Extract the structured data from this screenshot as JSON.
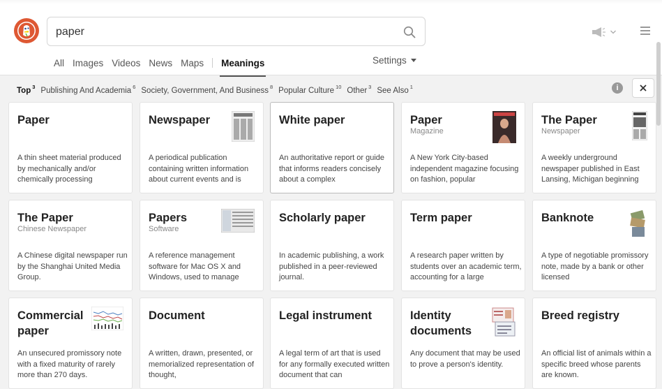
{
  "search": {
    "query": "paper"
  },
  "nav": {
    "all": "All",
    "images": "Images",
    "videos": "Videos",
    "news": "News",
    "maps": "Maps",
    "meanings": "Meanings",
    "settings": "Settings"
  },
  "filters": [
    {
      "label": "Top",
      "count": "3"
    },
    {
      "label": "Publishing And Academia",
      "count": "6"
    },
    {
      "label": "Society, Government, And Business",
      "count": "8"
    },
    {
      "label": "Popular Culture",
      "count": "10"
    },
    {
      "label": "Other",
      "count": "3"
    },
    {
      "label": "See Also",
      "count": "1"
    }
  ],
  "info_label": "i",
  "cards": [
    {
      "title": "Paper",
      "sub": "",
      "desc": "A thin sheet material produced by mechanically and/or chemically processing"
    },
    {
      "title": "Newspaper",
      "sub": "",
      "desc": "A periodical publication containing written information about current events and is"
    },
    {
      "title": "White paper",
      "sub": "",
      "desc": "An authoritative report or guide that informs readers concisely about a complex"
    },
    {
      "title": "Paper",
      "sub": "Magazine",
      "desc": "A New York City-based independent magazine focusing on fashion, popular"
    },
    {
      "title": "The Paper",
      "sub": "Newspaper",
      "desc": "A weekly underground newspaper published in East Lansing, Michigan beginning"
    },
    {
      "title": "The Paper",
      "sub": "Chinese Newspaper",
      "desc": "A Chinese digital newspaper run by the Shanghai United Media Group."
    },
    {
      "title": "Papers",
      "sub": "Software",
      "desc": "A reference management software for Mac OS X and Windows, used to manage"
    },
    {
      "title": "Scholarly paper",
      "sub": "",
      "desc": "In academic publishing, a work published in a peer-reviewed journal."
    },
    {
      "title": "Term paper",
      "sub": "",
      "desc": "A research paper written by students over an academic term, accounting for a large"
    },
    {
      "title": "Banknote",
      "sub": "",
      "desc": "A type of negotiable promissory note, made by a bank or other licensed"
    },
    {
      "title": "Commercial paper",
      "sub": "",
      "desc": "An unsecured promissory note with a fixed maturity of rarely more than 270 days."
    },
    {
      "title": "Document",
      "sub": "",
      "desc": "A written, drawn, presented, or memorialized representation of thought,"
    },
    {
      "title": "Legal instrument",
      "sub": "",
      "desc": "A legal term of art that is used for any formally executed written document that can"
    },
    {
      "title": "Identity documents",
      "sub": "",
      "desc": "Any document that may be used to prove a person's identity."
    },
    {
      "title": "Breed registry",
      "sub": "",
      "desc": "An official list of animals within a specific breed whose parents are known."
    }
  ],
  "colors": {
    "brand": "#de5833",
    "accent": "#333333"
  }
}
